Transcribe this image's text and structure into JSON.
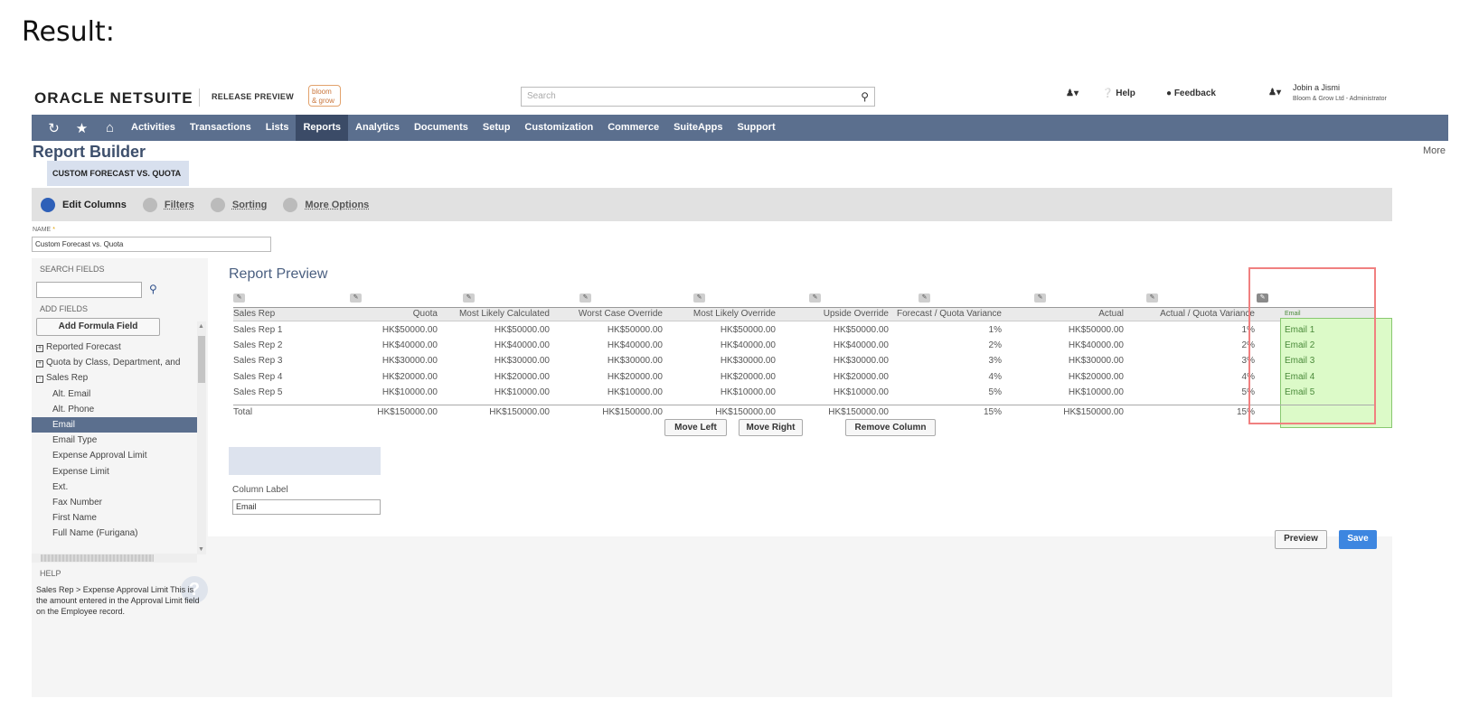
{
  "caption": "Result:",
  "header": {
    "logo_oracle": "ORACLE",
    "logo_netsuite": "NETSUITE",
    "release": "RELEASE PREVIEW",
    "brand": "bloom & grow",
    "search_placeholder": "Search",
    "help": "Help",
    "feedback": "Feedback",
    "user_name": "Jobin a Jismi",
    "user_role": "Bloom & Grow Ltd - Administrator"
  },
  "nav": {
    "items": [
      "Activities",
      "Transactions",
      "Lists",
      "Reports",
      "Analytics",
      "Documents",
      "Setup",
      "Customization",
      "Commerce",
      "SuiteApps",
      "Support"
    ],
    "active": "Reports"
  },
  "page": {
    "title": "Report Builder",
    "more": "More",
    "report_tag": "CUSTOM FORECAST VS. QUOTA",
    "steps": [
      "Edit Columns",
      "Filters",
      "Sorting",
      "More Options"
    ],
    "name_label": "NAME",
    "name_value": "Custom Forecast vs. Quota"
  },
  "left": {
    "search_fields": "SEARCH FIELDS",
    "add_fields": "ADD FIELDS",
    "add_formula": "Add Formula Field",
    "fields": [
      {
        "label": "Reported Forecast",
        "kind": "group",
        "sign": "+"
      },
      {
        "label": "Quota by Class, Department, and",
        "kind": "group",
        "sign": "+"
      },
      {
        "label": "Sales Rep",
        "kind": "group",
        "sign": "-"
      },
      {
        "label": "Alt. Email",
        "kind": "sub"
      },
      {
        "label": "Alt. Phone",
        "kind": "sub"
      },
      {
        "label": "Email",
        "kind": "sub",
        "selected": true
      },
      {
        "label": "Email Type",
        "kind": "sub"
      },
      {
        "label": "Expense Approval Limit",
        "kind": "sub"
      },
      {
        "label": "Expense Limit",
        "kind": "sub"
      },
      {
        "label": "Ext.",
        "kind": "sub"
      },
      {
        "label": "Fax Number",
        "kind": "sub"
      },
      {
        "label": "First Name",
        "kind": "sub"
      },
      {
        "label": "Full Name (Furigana)",
        "kind": "sub"
      }
    ],
    "help_heading": "HELP",
    "help_text": "Sales Rep > Expense Approval Limit This is the amount entered in the Approval Limit field on the Employee record."
  },
  "preview": {
    "title": "Report Preview",
    "columns": [
      "Sales Rep",
      "Quota",
      "Most Likely Calculated",
      "Worst Case Override",
      "Most Likely Override",
      "Upside Override",
      "Forecast / Quota Variance",
      "Actual",
      "Actual / Quota Variance",
      "Email"
    ],
    "rows": [
      [
        "Sales Rep 1",
        "HK$50000.00",
        "HK$50000.00",
        "HK$50000.00",
        "HK$50000.00",
        "HK$50000.00",
        "1%",
        "HK$50000.00",
        "1%",
        "Email 1"
      ],
      [
        "Sales Rep 2",
        "HK$40000.00",
        "HK$40000.00",
        "HK$40000.00",
        "HK$40000.00",
        "HK$40000.00",
        "2%",
        "HK$40000.00",
        "2%",
        "Email 2"
      ],
      [
        "Sales Rep 3",
        "HK$30000.00",
        "HK$30000.00",
        "HK$30000.00",
        "HK$30000.00",
        "HK$30000.00",
        "3%",
        "HK$30000.00",
        "3%",
        "Email 3"
      ],
      [
        "Sales Rep 4",
        "HK$20000.00",
        "HK$20000.00",
        "HK$20000.00",
        "HK$20000.00",
        "HK$20000.00",
        "4%",
        "HK$20000.00",
        "4%",
        "Email 4"
      ],
      [
        "Sales Rep 5",
        "HK$10000.00",
        "HK$10000.00",
        "HK$10000.00",
        "HK$10000.00",
        "HK$10000.00",
        "5%",
        "HK$10000.00",
        "5%",
        "Email 5"
      ]
    ],
    "total": [
      "Total",
      "HK$150000.00",
      "HK$150000.00",
      "HK$150000.00",
      "HK$150000.00",
      "HK$150000.00",
      "15%",
      "HK$150000.00",
      "15%",
      ""
    ],
    "move_left": "Move Left",
    "move_right": "Move Right",
    "remove_column": "Remove Column",
    "column_label": "Column Label",
    "column_label_value": "Email",
    "preview_btn": "Preview",
    "save_btn": "Save"
  },
  "colors": {
    "nav_bg": "#5b6f8e",
    "selected_column": "#dcfac8",
    "highlight_box": "#f08080",
    "save_button": "#3d86e0"
  }
}
